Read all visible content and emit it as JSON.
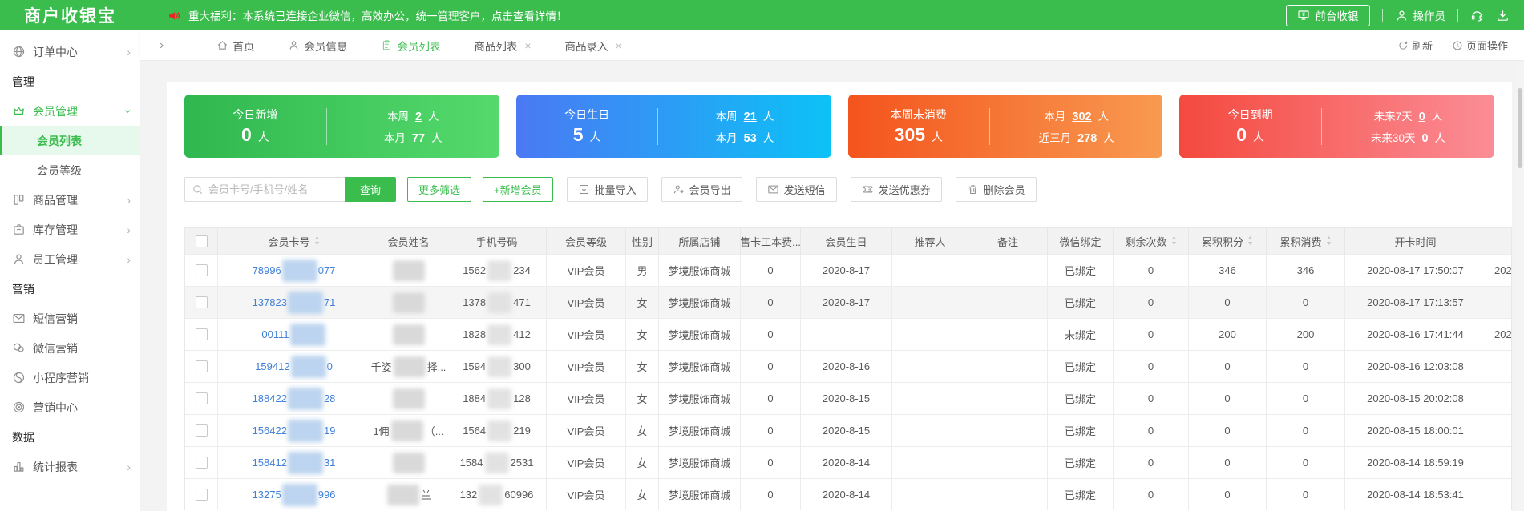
{
  "colors": {
    "green": "#3bbd4e",
    "link": "#3e7fd8"
  },
  "app": {
    "logo": "商户收银宝"
  },
  "topbar": {
    "announcement": "重大福利：本系统已连接企业微信，高效办公，统一管理客户，点击查看详情！",
    "cashier_button": "前台收银",
    "operator": "操作员"
  },
  "sidebar": {
    "sections": [
      {
        "heading": null,
        "items": [
          {
            "name": "order-center",
            "label": "订单中心",
            "icon": "globe",
            "chevron": "right"
          }
        ]
      },
      {
        "heading": "管理",
        "items": [
          {
            "name": "member-manage",
            "label": "会员管理",
            "icon": "crown",
            "chevron": "down",
            "active": true,
            "children": [
              {
                "name": "member-list",
                "label": "会员列表",
                "active": true
              },
              {
                "name": "member-level",
                "label": "会员等级",
                "active": false
              }
            ]
          },
          {
            "name": "product-manage",
            "label": "商品管理",
            "icon": "goods",
            "chevron": "right"
          },
          {
            "name": "stock-manage",
            "label": "库存管理",
            "icon": "inventory",
            "chevron": "right"
          },
          {
            "name": "staff-manage",
            "label": "员工管理",
            "icon": "person",
            "chevron": "right"
          }
        ]
      },
      {
        "heading": "营销",
        "items": [
          {
            "name": "sms-marketing",
            "label": "短信营销",
            "icon": "mail"
          },
          {
            "name": "wechat-marketing",
            "label": "微信营销",
            "icon": "wechat"
          },
          {
            "name": "miniapp-marketing",
            "label": "小程序营销",
            "icon": "miniapp"
          },
          {
            "name": "marketing-center",
            "label": "营销中心",
            "icon": "target"
          }
        ]
      },
      {
        "heading": "数据",
        "items": [
          {
            "name": "report-stats",
            "label": "统计报表",
            "icon": "chart",
            "chevron": "right"
          }
        ]
      }
    ]
  },
  "tabs": {
    "items": [
      {
        "name": "home",
        "label": "首页",
        "icon": "home"
      },
      {
        "name": "member-info",
        "label": "会员信息",
        "icon": "person"
      },
      {
        "name": "member-list",
        "label": "会员列表",
        "icon": "list",
        "active": true
      },
      {
        "name": "product-list",
        "label": "商品列表",
        "closable": true
      },
      {
        "name": "product-entry",
        "label": "商品录入",
        "closable": true
      }
    ],
    "refresh": "刷新",
    "page_ops": "页面操作"
  },
  "stat_cards": [
    {
      "name": "new-today",
      "label": "今日新增",
      "value": "0",
      "unit": "人",
      "gradient": [
        "#2fb84f",
        "#55d96c"
      ],
      "details": [
        {
          "label": "本周",
          "value": "2",
          "unit": "人"
        },
        {
          "label": "本月",
          "value": "77",
          "unit": "人"
        }
      ]
    },
    {
      "name": "birthday-today",
      "label": "今日生日",
      "value": "5",
      "unit": "人",
      "gradient": [
        "#4a79f4",
        "#0cc2f6"
      ],
      "details": [
        {
          "label": "本周",
          "value": "21",
          "unit": "人"
        },
        {
          "label": "本月",
          "value": "53",
          "unit": "人"
        }
      ]
    },
    {
      "name": "no-consume-week",
      "label": "本周未消费",
      "value": "305",
      "unit": "人",
      "gradient": [
        "#f4541d",
        "#f89a50"
      ],
      "details": [
        {
          "label": "本月",
          "value": "302",
          "unit": "人"
        },
        {
          "label": "近三月",
          "value": "278",
          "unit": "人"
        }
      ]
    },
    {
      "name": "expire-today",
      "label": "今日到期",
      "value": "0",
      "unit": "人",
      "gradient": [
        "#f4493e",
        "#fb8d96"
      ],
      "details": [
        {
          "label": "未来7天",
          "value": "0",
          "unit": "人"
        },
        {
          "label": "未来30天",
          "value": "0",
          "unit": "人"
        }
      ]
    }
  ],
  "toolbar": {
    "search_placeholder": "会员卡号/手机号/姓名",
    "query_button": "查询",
    "more_filter_button": "更多筛选",
    "add_member_button": "+新增会员",
    "action_buttons": [
      {
        "name": "batch-import",
        "label": "批量导入",
        "icon": "import"
      },
      {
        "name": "member-export",
        "label": "会员导出",
        "icon": "export"
      },
      {
        "name": "send-sms",
        "label": "发送短信",
        "icon": "mail"
      },
      {
        "name": "send-coupon",
        "label": "发送优惠券",
        "icon": "coupon"
      },
      {
        "name": "delete-member",
        "label": "删除会员",
        "icon": "trash"
      }
    ]
  },
  "table": {
    "columns": [
      "会员卡号",
      "会员姓名",
      "手机号码",
      "会员等级",
      "性别",
      "所属店铺",
      "售卡工本费...",
      "会员生日",
      "推荐人",
      "备注",
      "微信绑定",
      "剩余次数",
      "累积积分",
      "累积消费",
      "开卡时间",
      ""
    ],
    "rows": [
      {
        "card": [
          "78996",
          "077"
        ],
        "name": [
          "",
          ""
        ],
        "phone": [
          "1562",
          "234"
        ],
        "level": "VIP会员",
        "gender": "男",
        "store": "梦境服饰商城",
        "fee": "0",
        "birthday": "2020-8-17",
        "referrer": "",
        "note": "",
        "wechat": "已绑定",
        "times": "0",
        "points": "346",
        "spend": "346",
        "open": "2020-08-17 17:50:07",
        "extra": "202",
        "highlight": false
      },
      {
        "card": [
          "137823",
          "71"
        ],
        "name": [
          "",
          ""
        ],
        "phone": [
          "1378",
          "471"
        ],
        "level": "VIP会员",
        "gender": "女",
        "store": "梦境服饰商城",
        "fee": "0",
        "birthday": "2020-8-17",
        "referrer": "",
        "note": "",
        "wechat": "已绑定",
        "times": "0",
        "points": "0",
        "spend": "0",
        "open": "2020-08-17 17:13:57",
        "extra": "",
        "highlight": true
      },
      {
        "card": [
          "00111",
          ""
        ],
        "name": [
          "",
          ""
        ],
        "phone": [
          "1828",
          "412"
        ],
        "level": "VIP会员",
        "gender": "女",
        "store": "梦境服饰商城",
        "fee": "0",
        "birthday": "",
        "referrer": "",
        "note": "",
        "wechat": "未绑定",
        "times": "0",
        "points": "200",
        "spend": "200",
        "open": "2020-08-16 17:41:44",
        "extra": "202",
        "highlight": false
      },
      {
        "card": [
          "159412",
          "0"
        ],
        "name": [
          "千姿",
          "择..."
        ],
        "phone": [
          "1594",
          "300"
        ],
        "level": "VIP会员",
        "gender": "女",
        "store": "梦境服饰商城",
        "fee": "0",
        "birthday": "2020-8-16",
        "referrer": "",
        "note": "",
        "wechat": "已绑定",
        "times": "0",
        "points": "0",
        "spend": "0",
        "open": "2020-08-16 12:03:08",
        "extra": "",
        "highlight": false
      },
      {
        "card": [
          "188422",
          "28"
        ],
        "name": [
          "",
          ""
        ],
        "phone": [
          "1884",
          "128"
        ],
        "level": "VIP会员",
        "gender": "女",
        "store": "梦境服饰商城",
        "fee": "0",
        "birthday": "2020-8-15",
        "referrer": "",
        "note": "",
        "wechat": "已绑定",
        "times": "0",
        "points": "0",
        "spend": "0",
        "open": "2020-08-15 20:02:08",
        "extra": "",
        "highlight": false
      },
      {
        "card": [
          "156422",
          "19"
        ],
        "name": [
          "1佣",
          "（..."
        ],
        "phone": [
          "1564",
          "219"
        ],
        "level": "VIP会员",
        "gender": "女",
        "store": "梦境服饰商城",
        "fee": "0",
        "birthday": "2020-8-15",
        "referrer": "",
        "note": "",
        "wechat": "已绑定",
        "times": "0",
        "points": "0",
        "spend": "0",
        "open": "2020-08-15 18:00:01",
        "extra": "",
        "highlight": false
      },
      {
        "card": [
          "158412",
          "31"
        ],
        "name": [
          "",
          ""
        ],
        "phone": [
          "1584",
          "2531"
        ],
        "level": "VIP会员",
        "gender": "女",
        "store": "梦境服饰商城",
        "fee": "0",
        "birthday": "2020-8-14",
        "referrer": "",
        "note": "",
        "wechat": "已绑定",
        "times": "0",
        "points": "0",
        "spend": "0",
        "open": "2020-08-14 18:59:19",
        "extra": "",
        "highlight": false
      },
      {
        "card": [
          "13275",
          "996"
        ],
        "name": [
          "",
          "兰"
        ],
        "phone": [
          "132",
          "60996"
        ],
        "level": "VIP会员",
        "gender": "女",
        "store": "梦境服饰商城",
        "fee": "0",
        "birthday": "2020-8-14",
        "referrer": "",
        "note": "",
        "wechat": "已绑定",
        "times": "0",
        "points": "0",
        "spend": "0",
        "open": "2020-08-14 18:53:41",
        "extra": "",
        "highlight": false
      }
    ]
  }
}
